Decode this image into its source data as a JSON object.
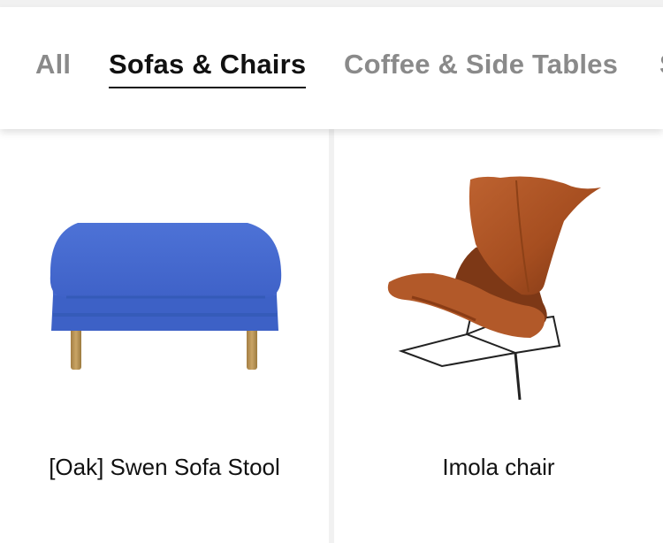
{
  "tabs": [
    {
      "label": "All",
      "active": false
    },
    {
      "label": "Sofas & Chairs",
      "active": true
    },
    {
      "label": "Coffee & Side Tables",
      "active": false
    },
    {
      "label": "S",
      "active": false
    }
  ],
  "products": [
    {
      "name": "[Oak] Swen Sofa Stool",
      "image": "blue-sofa-stool"
    },
    {
      "name": "Imola chair",
      "image": "brown-leather-lounge-chair"
    }
  ],
  "colors": {
    "active_tab": "#111111",
    "inactive_tab": "#8a8a8a",
    "background": "#f1f1f1",
    "card": "#ffffff"
  }
}
